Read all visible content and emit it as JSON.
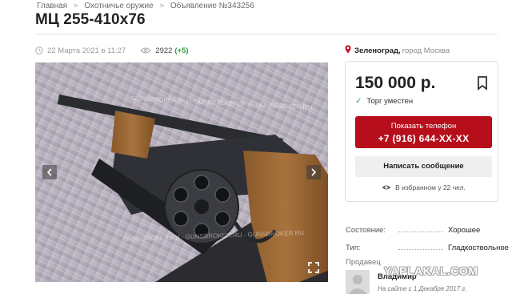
{
  "breadcrumb": [
    {
      "label": "Главная"
    },
    {
      "label": "Охотничье оружие"
    },
    {
      "label": "Объявление №343256"
    }
  ],
  "title": "МЦ 255-410х76",
  "meta": {
    "date": "22 Марта 2021 в 11:27",
    "views": "2922",
    "views_delta": "(+5)"
  },
  "location": {
    "city": "Зеленоград,",
    "region": "город Москва"
  },
  "gallery": {
    "watermark_text": "GUNSBROKER.RU - GUNSBROKER.RU - GUNSBROKER.RU"
  },
  "offer": {
    "price": "150 000 р.",
    "haggle": "Торг уместен",
    "phone_label": "Показать телефон",
    "phone_number": "+7 (916) 644-XX-XX",
    "message_button": "Написать сообщение",
    "favorites": "В избранном у 22 чел."
  },
  "properties": [
    {
      "key": "Состояние:",
      "value": "Хорошее"
    },
    {
      "key": "Тип:",
      "value": "Гладкоствольное"
    }
  ],
  "seller": {
    "label": "Продавец",
    "name": "Владимир",
    "since": "На сайте с 1 Декабря 2017 г."
  },
  "site_watermark": "YAPLAKAL.COM",
  "colors": {
    "accent": "#b70e1b",
    "positive": "#2e9e3e",
    "location_pin": "#c8102e"
  },
  "icons": [
    "chevron-right-icon",
    "clock-icon",
    "eye-icon",
    "location-pin-icon",
    "bookmark-icon",
    "check-icon",
    "eye-icon",
    "arrow-left-icon",
    "arrow-right-icon",
    "fullscreen-icon"
  ]
}
